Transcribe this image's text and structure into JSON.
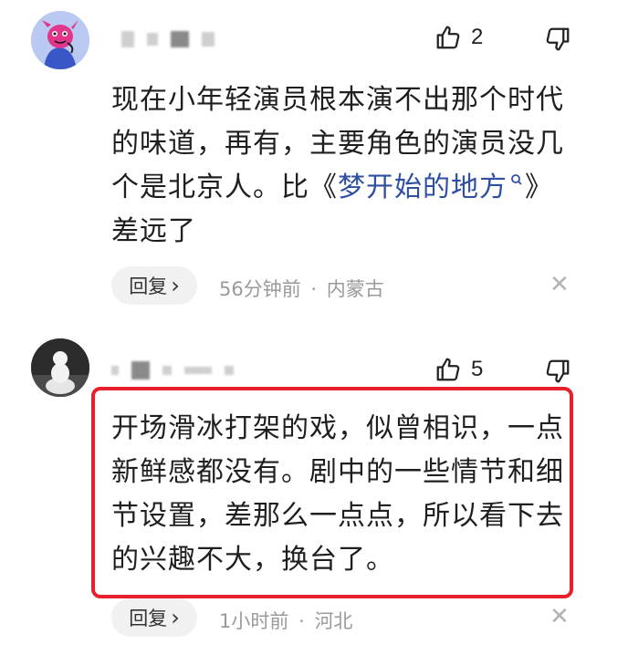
{
  "comments": [
    {
      "likes": "2",
      "text_before_link": "现在小年轻演员根本演不出那个时代的味道，再有，主要角色的演员没几个是北京人。比《",
      "link_text": "梦开始的地方",
      "text_after_link": "》差远了",
      "reply_label": "回复",
      "reply_arrow": "›",
      "time": "56分钟前",
      "separator": "·",
      "location": "内蒙古"
    },
    {
      "likes": "5",
      "text": "开场滑冰打架的戏，似曾相识，一点新鲜感都没有。剧中的一些情节和细节设置，差那么一点点，所以看下去的兴趣不大，换台了。",
      "reply_label": "回复",
      "reply_arrow": "›",
      "time": "1小时前",
      "separator": "·",
      "location": "河北"
    }
  ],
  "icons": {
    "like": "thumbs-up-icon",
    "dislike": "thumbs-down-icon",
    "close": "close-icon",
    "search": "search-icon"
  },
  "colors": {
    "link": "#2f4fa3",
    "highlight_border": "#e8202b",
    "meta_text": "#9a9a9a"
  }
}
